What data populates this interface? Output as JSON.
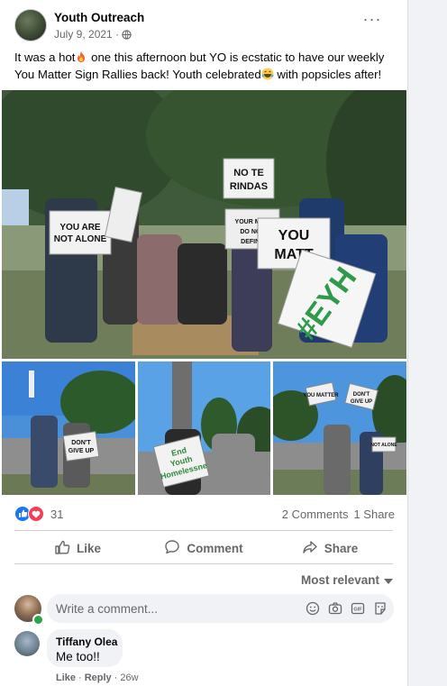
{
  "post": {
    "page_name": "Youth Outreach",
    "date": "July 9, 2021 · ",
    "text_part1": "It was a hot",
    "text_part2": " one this afternoon but YO is ecstatic to have our weekly You Matter Sign Rallies back! Youth celebrated",
    "text_part3": " with popsicles after!",
    "more_label": "···"
  },
  "photos": {
    "main_signs": [
      "YOU ARE NOT ALONE",
      "NO TE RINDAS",
      "YOUR MIST DO NOT DEFINE",
      "YOU MATT",
      "#EYH"
    ],
    "small1_sign": "DON'T GIVE UP",
    "small2_sign": "End Youth Homelessness",
    "small3_signs": [
      "YOU MATTER",
      "DON'T GIVE UP",
      "YOU ARE NOT ALONE"
    ]
  },
  "stats": {
    "reaction_count": "31",
    "comments": "2 Comments",
    "shares": "1 Share"
  },
  "actions": {
    "like": "Like",
    "comment": "Comment",
    "share": "Share"
  },
  "comments_section": {
    "sort_label": "Most relevant",
    "placeholder": "Write a comment...",
    "items": [
      {
        "author": "Tiffany Olea",
        "text": "Me too!!",
        "like": "Like",
        "reply": "Reply",
        "time": "26w"
      }
    ]
  },
  "colors": {
    "like_blue": "#1877f2",
    "love_red": "#f33e58",
    "text_muted": "#65676b"
  },
  "icons": [
    "globe-icon",
    "like-icon",
    "comment-icon",
    "share-icon",
    "chevron-down-icon",
    "smiley-icon",
    "camera-icon",
    "gif-icon",
    "sticker-icon",
    "fire-emoji",
    "laughing-emoji"
  ]
}
